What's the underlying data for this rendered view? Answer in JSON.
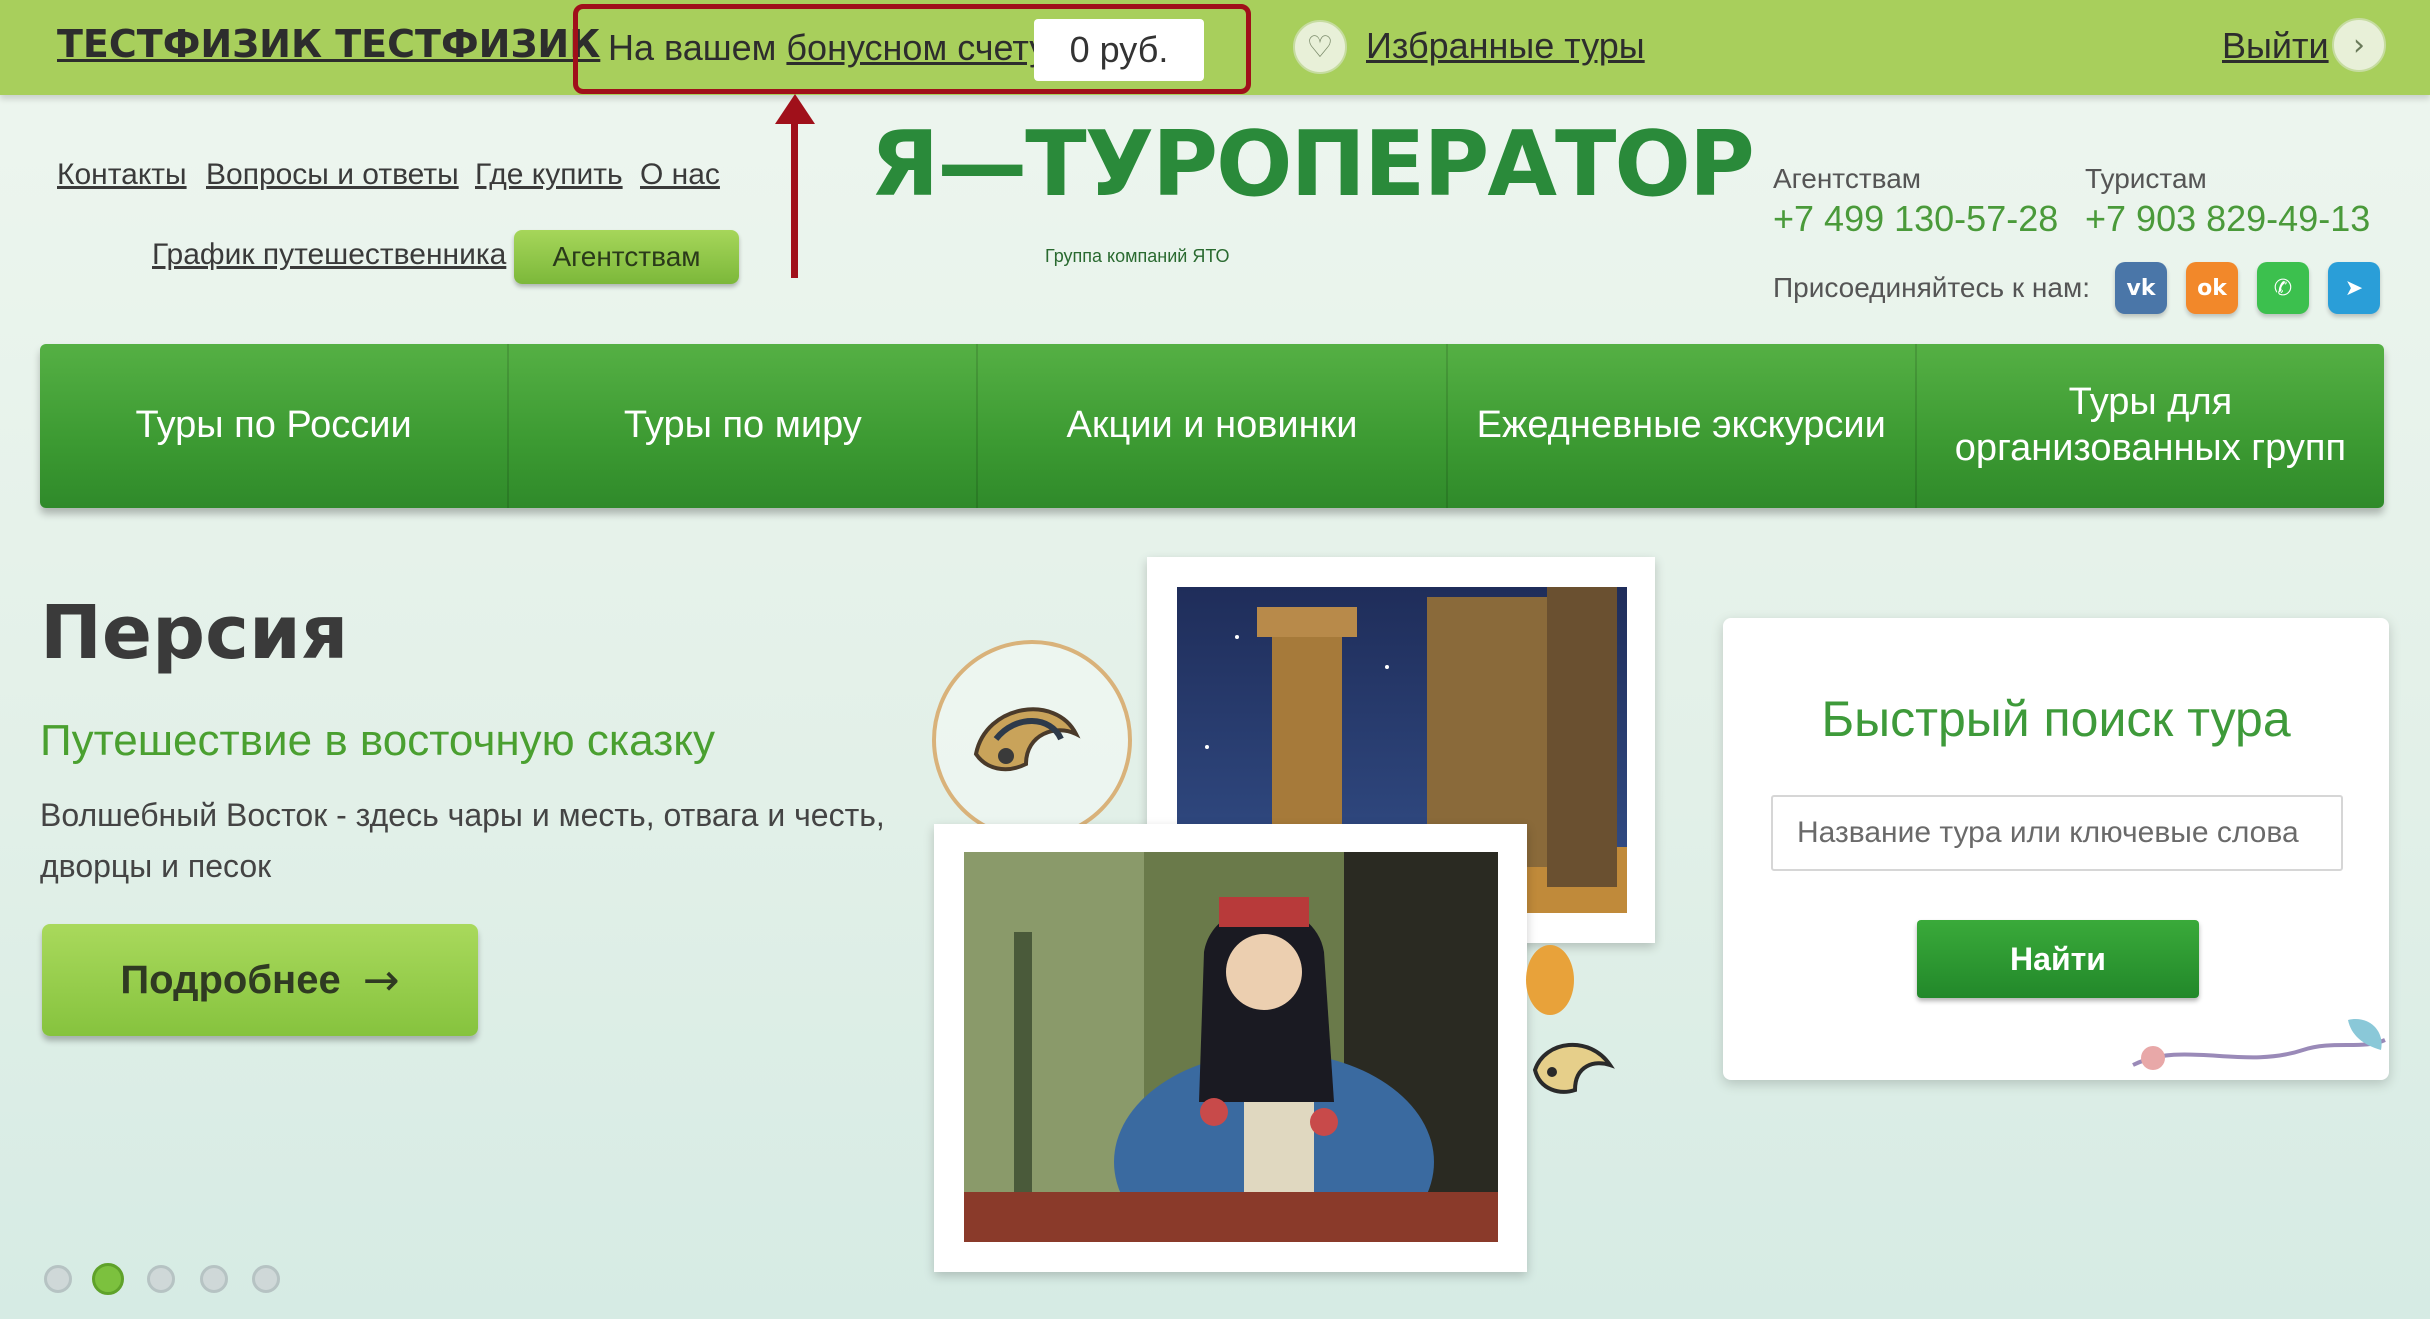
{
  "topbar": {
    "user_name": "ТЕСТФИЗИК ТЕСТФИЗИК",
    "bonus_prefix": "На вашем ",
    "bonus_link": "бонусном счету",
    "bonus_value": "0 руб.",
    "favorites_label": "Избранные туры",
    "logout_label": "Выйти",
    "icons": {
      "favorites": "heart-icon",
      "logout": "chevron-right-icon"
    }
  },
  "header": {
    "links": [
      "Контакты",
      "Вопросы и ответы",
      "Где купить",
      "О нас",
      "График путешественника"
    ],
    "agency_button": "Агентствам",
    "logo_main": "Я—ТУРОПЕРАТОР",
    "logo_sub": "Группа компаний ЯТО",
    "contacts": [
      {
        "label": "Агентствам",
        "phone": "+7 499 130-57-28"
      },
      {
        "label": "Туристам",
        "phone": "+7 903 829-49-13"
      }
    ],
    "join_label": "Присоединяйтесь к нам:",
    "social": [
      {
        "icon": "vk-icon",
        "glyph": "vk",
        "color": "#4a76a8"
      },
      {
        "icon": "odnoklassniki-icon",
        "glyph": "ok",
        "color": "#f2882a"
      },
      {
        "icon": "whatsapp-icon",
        "glyph": "✆",
        "color": "#3cc04e"
      },
      {
        "icon": "telegram-icon",
        "glyph": "➤",
        "color": "#2a9ed8"
      }
    ]
  },
  "mainnav": [
    "Туры по России",
    "Туры по миру",
    "Акции и новинки",
    "Ежедневные экскурсии",
    "Туры для организованных групп"
  ],
  "hero": {
    "title": "Персия",
    "subtitle": "Путешествие в восточную сказку",
    "description": "Волшебный Восток - здесь чары и месть, отвага и честь, дворцы и песок",
    "more_button": "Подробнее",
    "more_icon": "arrow-right-icon"
  },
  "search": {
    "title": "Быстрый поиск тура",
    "placeholder": "Название тура или ключевые слова",
    "button": "Найти"
  },
  "slider": {
    "count": 5,
    "active": 2
  },
  "colors": {
    "topbar": "#a8cf5c",
    "nav_green": "#3c9a32",
    "accent_red": "#a0101a",
    "subtitle_green": "#4aa030"
  }
}
